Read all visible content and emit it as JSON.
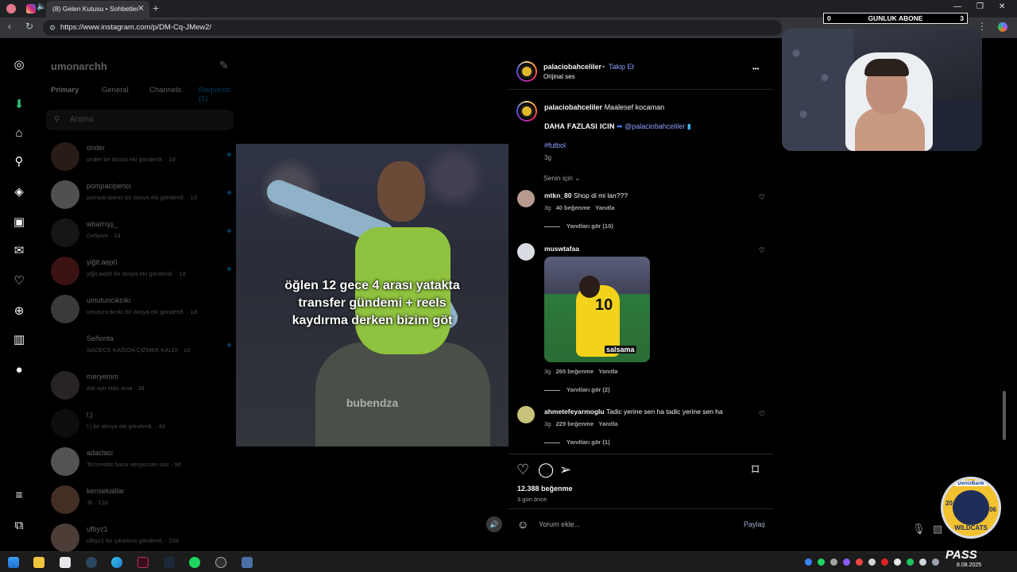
{
  "browser": {
    "tab_title": "(8) Gelen Kutusu • Sohbetler",
    "url": "https://www.instagram.com/p/DM-Cq-JMew2/",
    "new_tab": "+",
    "tab_close": "✕"
  },
  "overlay": {
    "counter_left": "0",
    "counter_label": "GUNLUK ABONE",
    "counter_right": "3",
    "badge_sponsor": "DenizBank",
    "badge_year_left": "20",
    "badge_year_right": "06",
    "badge_name": "WILDCATS",
    "pass_text": "PASS",
    "pass_date": "8.08.2025"
  },
  "messages": {
    "username": "umonarchh",
    "tabs": [
      "Primary",
      "General",
      "Channels",
      "Requests (1)"
    ],
    "search_placeholder": "Arama",
    "conversations": [
      {
        "name": "onder",
        "preview": "onder bir dosya eki gönderdi. · 1d",
        "unread": true
      },
      {
        "name": "pompacipenci",
        "preview": "pompacipenci bir dosya eki gönderdi. · 1d",
        "unread": true
      },
      {
        "name": "wbarrışş_",
        "preview": "Geliyom · 1d",
        "unread": true
      },
      {
        "name": "yiğit.aep0",
        "preview": "yiğit.aep0 bir dosya eki gönderdi. · 1d",
        "unread": true
      },
      {
        "name": "umutuncıkcıkı",
        "preview": "umutuncıkcıkı bir dosya eki gönderdi. · 1d",
        "unread": false
      },
      {
        "name": "Señorita",
        "preview": "SADECE KAĞIDA ÇIZMEK KALDI · 1d",
        "unread": true
      },
      {
        "name": "meryemm",
        "preview": "Abi aylı oldu ama · 3d",
        "unread": false
      },
      {
        "name": "l:)",
        "preview": "l:) bir dosya eki gönderdi. · 4d",
        "unread": false
      },
      {
        "name": "adaclaci",
        "preview": "Tezzenide bana veriyorsan olur · 9d",
        "unread": false
      },
      {
        "name": "kensekalilar",
        "preview": "Jk · 12d",
        "unread": false
      },
      {
        "name": "ufbyz1",
        "preview": "ufbyz1 bir çıkartma gönderdi. · 23d",
        "unread": false
      }
    ]
  },
  "post": {
    "video_caption_lines": [
      "öğlen 12 gece 4 arası yatakta",
      "transfer gündemi + reels",
      "kaydırma derken bizim göt"
    ],
    "watermark": "bubendza",
    "author": "palaciobahceliler",
    "follow": "Takip Et",
    "audio": "Orijinal ses",
    "more": "•••",
    "caption": "Maalesef kocaman",
    "promo_text": "𝐃𝐀𝐇𝐀 𝐅𝐀𝐙𝐋𝐀𝐒𝐈 𝐈𝐂𝐈𝐍",
    "promo_handle": "@palaciobahceliler",
    "hashtag": "#futbol",
    "caption_age": "3g",
    "for_you": "Senin için",
    "comments": [
      {
        "user": "mtkn_80",
        "text": "Shop di mi lan???",
        "age": "3g",
        "likes": "40 beğenme",
        "reply": "Yanıtla",
        "view_replies": "Yanıtları gör (10)"
      },
      {
        "user": "muswtafaa",
        "text": "",
        "age": "3g",
        "likes": "265 beğenme",
        "reply": "Yanıtla",
        "view_replies": "Yanıtları gör (2)",
        "gif_number": "10",
        "gif_text": "salsama"
      },
      {
        "user": "ahmetefeyarmoglu",
        "text": "Tadic yerine sen ha tadic yerine sen ha",
        "age": "3g",
        "likes": "229 beğenme",
        "reply": "Yanıtla",
        "view_replies": "Yanıtları gör (1)"
      }
    ],
    "like_count": "12.388 beğenme",
    "posted_ago": "3 gün önce",
    "comment_placeholder": "Yorum ekle...",
    "share_button": "Paylaş"
  },
  "colors": {
    "accent_blue": "#0095f6",
    "background": "#000000",
    "panel": "#000000",
    "text": "#f5f5f5",
    "muted": "#a8a8a8"
  }
}
